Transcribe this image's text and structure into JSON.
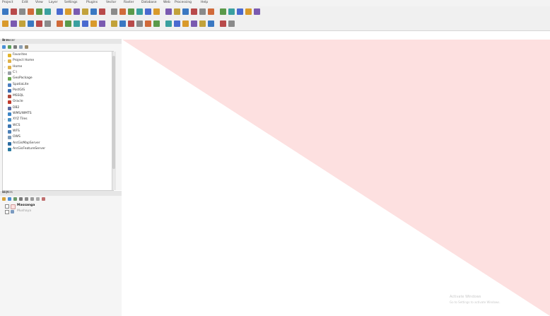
{
  "menubar": {
    "items": [
      "Project",
      "Edit",
      "View",
      "Layer",
      "Settings",
      "Plugins",
      "Vector",
      "Raster",
      "Database",
      "Web",
      "Processing",
      "Help"
    ]
  },
  "colors": {
    "canvas_fill": "#fde0e0",
    "toolbar_bg": "#f0f0f0",
    "panel_bg": "#f5f5f5"
  },
  "browser": {
    "title": "Browser",
    "controls": "⊞ ✕",
    "items": [
      {
        "label": "Favorites",
        "icon": "star-icon",
        "expander": ""
      },
      {
        "label": "Project Home",
        "icon": "folder-icon",
        "expander": "›"
      },
      {
        "label": "Home",
        "icon": "folder-icon",
        "expander": "›"
      },
      {
        "label": "C:\\",
        "icon": "drive-icon",
        "expander": "›"
      },
      {
        "label": "GeoPackage",
        "icon": "geopackage-icon",
        "expander": ""
      },
      {
        "label": "SpatiaLite",
        "icon": "spatialite-icon",
        "expander": ""
      },
      {
        "label": "PostGIS",
        "icon": "postgis-icon",
        "expander": ""
      },
      {
        "label": "MSSQL",
        "icon": "mssql-icon",
        "expander": ""
      },
      {
        "label": "Oracle",
        "icon": "oracle-icon",
        "expander": ""
      },
      {
        "label": "DB2",
        "icon": "db2-icon",
        "expander": ""
      },
      {
        "label": "WMS/WMTS",
        "icon": "wms-icon",
        "expander": ""
      },
      {
        "label": "XYZ Tiles",
        "icon": "xyz-tiles-icon",
        "expander": "›"
      },
      {
        "label": "WCS",
        "icon": "wcs-icon",
        "expander": ""
      },
      {
        "label": "WFS",
        "icon": "wfs-icon",
        "expander": ""
      },
      {
        "label": "OWS",
        "icon": "ows-icon",
        "expander": ""
      },
      {
        "label": "ArcGisMapServer",
        "icon": "arcgis-map-icon",
        "expander": ""
      },
      {
        "label": "ArcGisFeatureServer",
        "icon": "arcgis-feature-icon",
        "expander": ""
      }
    ]
  },
  "layers": {
    "title": "Layers",
    "controls": "⊞ ✕",
    "items": [
      {
        "label": "Massanga",
        "icon": "polygon-layer-icon"
      },
      {
        "label": "Mushaya",
        "icon": "raster-layer-icon"
      }
    ]
  },
  "watermark": {
    "line1": "Activate Windows",
    "line2": "Go to Settings to activate Windows."
  }
}
